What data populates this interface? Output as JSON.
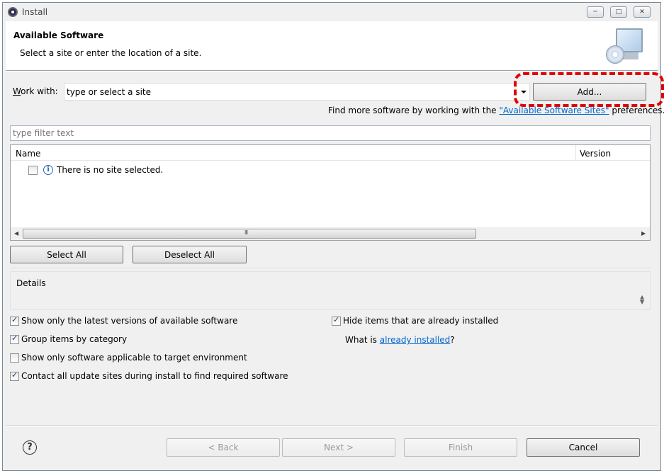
{
  "window": {
    "title": "Install",
    "controls": {
      "minimize": "─",
      "maximize": "□",
      "close": "✕"
    }
  },
  "header": {
    "title": "Available Software",
    "subtitle": "Select a site or enter the location of a site.",
    "icon": "monitor-cd-icon"
  },
  "work_with": {
    "label": "Work with:",
    "value": "type or select a site",
    "add_button": "Add..."
  },
  "find_more": {
    "prefix": "Find more software by working with the ",
    "link": "\"Available Software Sites\"",
    "suffix": " preferences."
  },
  "filter": {
    "placeholder": "type filter text"
  },
  "tree": {
    "columns": [
      "Name",
      "Version"
    ],
    "rows": [
      {
        "text": "There is no site selected.",
        "checked": false,
        "icon": "info-icon"
      }
    ],
    "scroll_grip": "III"
  },
  "selection_buttons": {
    "select_all": "Select All",
    "deselect_all": "Deselect All"
  },
  "details": {
    "label": "Details"
  },
  "options": {
    "latest_versions": {
      "label": "Show only the latest versions of available software",
      "checked": true
    },
    "group_by_category": {
      "label": "Group items by category",
      "checked": true
    },
    "target_env": {
      "label": "Show only software applicable to target environment",
      "checked": false
    },
    "contact_sites": {
      "label": "Contact all update sites during install to find required software",
      "checked": true
    },
    "hide_installed": {
      "label": "Hide items that are already installed",
      "checked": true
    }
  },
  "already_installed": {
    "prefix": "What is ",
    "link": "already installed",
    "suffix": "?"
  },
  "footer": {
    "help": "?",
    "back": "< Back",
    "next": "Next >",
    "finish": "Finish",
    "cancel": "Cancel"
  },
  "colors": {
    "highlight": "#e00000",
    "link": "#0066cc",
    "dialog_bg": "#f0f0f0"
  }
}
